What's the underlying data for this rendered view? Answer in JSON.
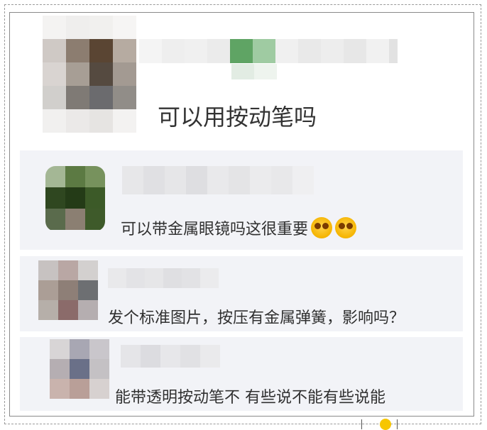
{
  "post": {
    "text": "可以用按动笔吗"
  },
  "replies": [
    {
      "text": "可以带金属眼镜吗这很重要",
      "emoji": [
        "blush-face-emoji",
        "blush-face-emoji"
      ]
    },
    {
      "text": "发个标准图片，按压有金属弹簧，影响吗？"
    },
    {
      "text": "能带透明按动笔不 有些说不能有些说能"
    }
  ],
  "colors": {
    "reply_background": "#f2f3f7",
    "text": "#333333",
    "emoji": "#f5b400"
  }
}
